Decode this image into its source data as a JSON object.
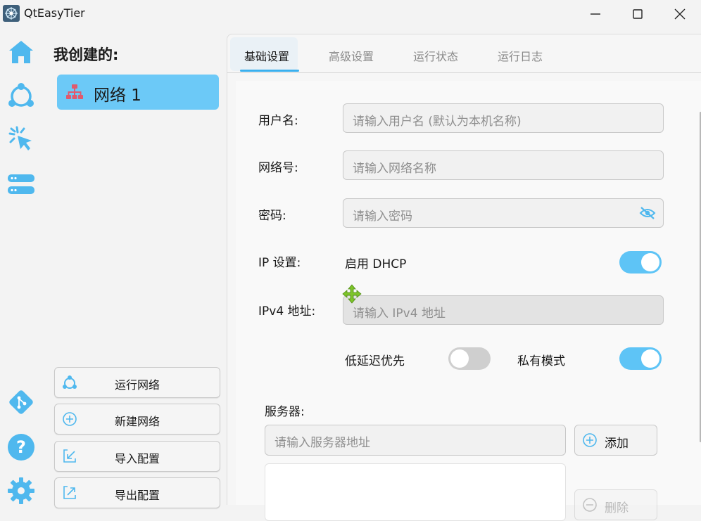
{
  "window": {
    "title": "QtEasyTier",
    "minimize_icon": "minimize-icon",
    "maximize_icon": "maximize-icon",
    "close_icon": "close-icon"
  },
  "leftbar": {
    "items": [
      {
        "name": "home-icon"
      },
      {
        "name": "network-nodes-icon"
      },
      {
        "name": "click-pointer-icon"
      },
      {
        "name": "server-list-icon"
      },
      {
        "name": "git-icon"
      },
      {
        "name": "help-icon"
      },
      {
        "name": "settings-gear-icon"
      }
    ]
  },
  "network_panel": {
    "title": "我创建的:",
    "items": [
      {
        "label": "网络 1",
        "icon": "network-topology-icon"
      }
    ],
    "actions": [
      {
        "label": "运行网络",
        "icon": "network-nodes-icon"
      },
      {
        "label": "新建网络",
        "icon": "plus-circle-icon"
      },
      {
        "label": "导入配置",
        "icon": "import-icon"
      },
      {
        "label": "导出配置",
        "icon": "export-icon"
      }
    ]
  },
  "tabs": [
    {
      "label": "基础设置",
      "active": true
    },
    {
      "label": "高级设置",
      "active": false
    },
    {
      "label": "运行状态",
      "active": false
    },
    {
      "label": "运行日志",
      "active": false
    }
  ],
  "form": {
    "username": {
      "label": "用户名:",
      "placeholder": "请输入用户名 (默认为本机名称)"
    },
    "network": {
      "label": "网络号:",
      "placeholder": "请输入网络名称"
    },
    "password": {
      "label": "密码:",
      "placeholder": "请输入密码",
      "icon": "eye-hidden-icon"
    },
    "ip": {
      "label": "IP 设置:",
      "dhcp_label": "启用 DHCP",
      "dhcp_on": true
    },
    "ipv4": {
      "label": "IPv4 地址:",
      "placeholder": "请输入 IPv4 地址",
      "disabled": true
    },
    "low_latency": {
      "label": "低延迟优先",
      "on": false
    },
    "private_mode": {
      "label": "私有模式",
      "on": true
    },
    "servers": {
      "label": "服务器:",
      "placeholder": "请输入服务器地址",
      "add_label": "添加",
      "delete_label": "删除"
    }
  },
  "colors": {
    "accent": "#5ec4f6",
    "selected_item": "#6cc9f7",
    "topology_icon": "#e05a6e",
    "move_cursor": "#7dc42a"
  }
}
